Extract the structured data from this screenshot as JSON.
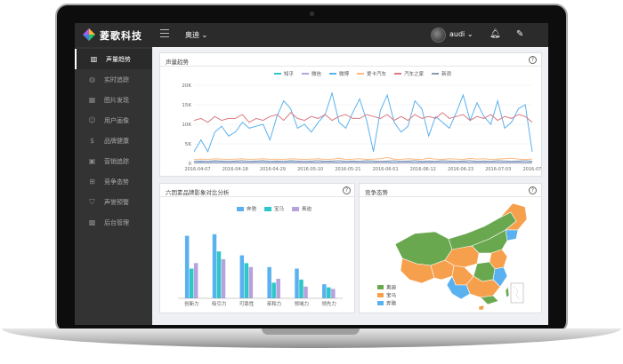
{
  "app": {
    "brand": "菱歌科技",
    "selected_brand": "奥迪",
    "user": "audi"
  },
  "sidebar": {
    "items": [
      {
        "label": "声量趋势",
        "icon": "bar-chart-icon",
        "active": true
      },
      {
        "label": "实时追踪",
        "icon": "globe-icon",
        "active": false
      },
      {
        "label": "图片发现",
        "icon": "image-icon",
        "active": false
      },
      {
        "label": "用户画像",
        "icon": "user-icon",
        "active": false
      },
      {
        "label": "品牌健康",
        "icon": "dollar-icon",
        "active": false
      },
      {
        "label": "营销追踪",
        "icon": "megaphone-icon",
        "active": false
      },
      {
        "label": "竞争态势",
        "icon": "sitemap-icon",
        "active": false
      },
      {
        "label": "声誉预警",
        "icon": "shield-icon",
        "active": false
      },
      {
        "label": "后台管理",
        "icon": "grid-icon",
        "active": false
      }
    ]
  },
  "panels": {
    "trend_title": "声量趋势",
    "radar_title": "六因素品牌影象对比分析",
    "map_title": "竞争态势",
    "help": "?"
  },
  "colors": {
    "zhihu": "#2ec7c9",
    "weixin": "#b6a2de",
    "weibo": "#5ab1ef",
    "aika": "#ffb980",
    "autohome": "#d87a80",
    "xinlang": "#8d98b3",
    "bar_benchi": "#5ab1ef",
    "bar_baoma": "#2ec7c9",
    "bar_aodi": "#b6a2de",
    "map_aodi": "#6aa84f",
    "map_baoma": "#f6a04d",
    "map_benchi": "#5ab1ef"
  },
  "chart_data": [
    {
      "type": "line",
      "title": "声量趋势",
      "x_tick_labels": [
        "2016-04-07",
        "2016-04-18",
        "2016-04-29",
        "2016-05-10",
        "2016-05-21",
        "2016-06-01",
        "2016-06-12",
        "2016-06-23",
        "2016-07-03",
        "2016-07-12"
      ],
      "y_tick_labels": [
        "0",
        "5K",
        "10K",
        "15K",
        "20K"
      ],
      "ylim": [
        0,
        20000
      ],
      "grid": true,
      "legend_position": "top-center",
      "series": [
        {
          "name": "知乎",
          "values": [
            300,
            350,
            300,
            400,
            350,
            300,
            400,
            350,
            300,
            350,
            400,
            300,
            350,
            300,
            400,
            350,
            300,
            350,
            300,
            400,
            350,
            300,
            350,
            400,
            300,
            350,
            300,
            400,
            350,
            300,
            350,
            400,
            300,
            350,
            300,
            400,
            350,
            300,
            350,
            400,
            300,
            350,
            300,
            400,
            350,
            300,
            350,
            400,
            300,
            350
          ]
        },
        {
          "name": "微信",
          "values": [
            200,
            250,
            200,
            300,
            250,
            200,
            300,
            250,
            200,
            250,
            300,
            200,
            250,
            200,
            300,
            250,
            200,
            250,
            200,
            300,
            250,
            200,
            250,
            300,
            200,
            250,
            200,
            300,
            250,
            200,
            250,
            300,
            200,
            250,
            200,
            300,
            250,
            200,
            250,
            300,
            200,
            250,
            200,
            300,
            250,
            200,
            250,
            300,
            200,
            250
          ]
        },
        {
          "name": "微博",
          "values": [
            3000,
            6000,
            3000,
            8000,
            9500,
            7000,
            8000,
            10500,
            9000,
            9500,
            10000,
            6000,
            12000,
            16000,
            14000,
            9000,
            10000,
            8000,
            10500,
            12500,
            18000,
            10500,
            9000,
            13000,
            16500,
            11000,
            3000,
            13500,
            17500,
            10500,
            8000,
            9500,
            16000,
            14000,
            7000,
            12000,
            10500,
            9000,
            13000,
            17500,
            11000,
            15500,
            12000,
            10000,
            16000,
            9000,
            10500,
            14000,
            15000,
            3000
          ]
        },
        {
          "name": "爱卡汽车",
          "values": [
            1000,
            1100,
            1000,
            1200,
            1100,
            1000,
            1100,
            1200,
            1000,
            1100,
            1200,
            1000,
            1100,
            1000,
            1200,
            1100,
            1000,
            1100,
            1200,
            1000,
            1100,
            1300,
            1000,
            1100,
            1200,
            1000,
            1100,
            1200,
            1500,
            1100,
            1000,
            1200,
            1100,
            1000,
            1300,
            1100,
            1000,
            1200,
            1100,
            1000,
            1300,
            1100,
            1200,
            1000,
            1100,
            1200,
            1300,
            1100,
            1000,
            1100
          ]
        },
        {
          "name": "汽车之家",
          "values": [
            11000,
            11500,
            10500,
            12000,
            11000,
            11500,
            11500,
            12500,
            10500,
            11500,
            11000,
            12000,
            12500,
            11000,
            13000,
            11500,
            11000,
            12000,
            11500,
            12500,
            11000,
            12000,
            12500,
            11500,
            11500,
            12500,
            12000,
            11500,
            12500,
            11000,
            12000,
            11000,
            12500,
            11500,
            12000,
            11500,
            13000,
            11500,
            12000,
            12500,
            11000,
            12000,
            11500,
            12500,
            11000,
            12000,
            11500,
            12500,
            12000,
            10500
          ]
        },
        {
          "name": "新浪",
          "values": [
            500,
            600,
            500,
            700,
            600,
            500,
            600,
            700,
            500,
            600,
            700,
            500,
            600,
            500,
            700,
            600,
            500,
            600,
            700,
            500,
            600,
            700,
            500,
            600,
            500,
            700,
            600,
            500,
            600,
            700,
            500,
            600,
            700,
            500,
            600,
            500,
            700,
            600,
            500,
            600,
            700,
            500,
            600,
            500,
            700,
            600,
            500,
            600,
            700,
            500
          ]
        }
      ]
    },
    {
      "type": "bar",
      "title": "六因素品牌影象对比分析",
      "categories": [
        "创新力",
        "吸引力",
        "可靠性",
        "亲和力",
        "领域力",
        "领先力"
      ],
      "ylim": [
        0,
        100
      ],
      "series": [
        {
          "name": "奔驰",
          "values": [
            80,
            82,
            55,
            40,
            38,
            18
          ]
        },
        {
          "name": "宝马",
          "values": [
            38,
            60,
            45,
            20,
            24,
            14
          ]
        },
        {
          "name": "奥迪",
          "values": [
            45,
            50,
            40,
            25,
            15,
            12
          ]
        }
      ]
    }
  ],
  "map": {
    "legend": [
      {
        "name": "奥迪",
        "color_key": "map_aodi"
      },
      {
        "name": "宝马",
        "color_key": "map_baoma"
      },
      {
        "name": "奔驰",
        "color_key": "map_benchi"
      }
    ]
  }
}
